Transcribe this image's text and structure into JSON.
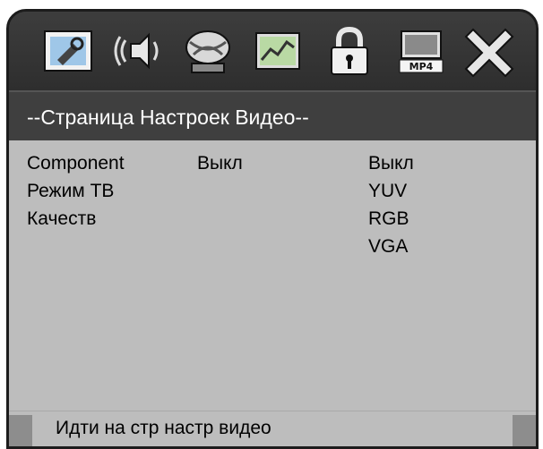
{
  "toolbar": {
    "icons": [
      {
        "name": "general-setup-icon"
      },
      {
        "name": "audio-setup-icon"
      },
      {
        "name": "video-setup-icon"
      },
      {
        "name": "preference-icon"
      },
      {
        "name": "password-lock-icon"
      },
      {
        "name": "mp4-setup-icon"
      },
      {
        "name": "exit-icon"
      }
    ]
  },
  "header": {
    "title": "--Страница Настроек Видео--"
  },
  "settings": {
    "labels": [
      "Component",
      "Режим ТВ",
      "Качеств"
    ],
    "current_value": "Выкл",
    "options": [
      "Выкл",
      "YUV",
      "RGB",
      "VGA"
    ]
  },
  "footer": {
    "text": "Идти на стр настр видео"
  },
  "colors": {
    "frame": "#3a3a3a",
    "content_bg": "#bdbdbd",
    "header_text": "#ffffff",
    "body_text": "#000000"
  }
}
